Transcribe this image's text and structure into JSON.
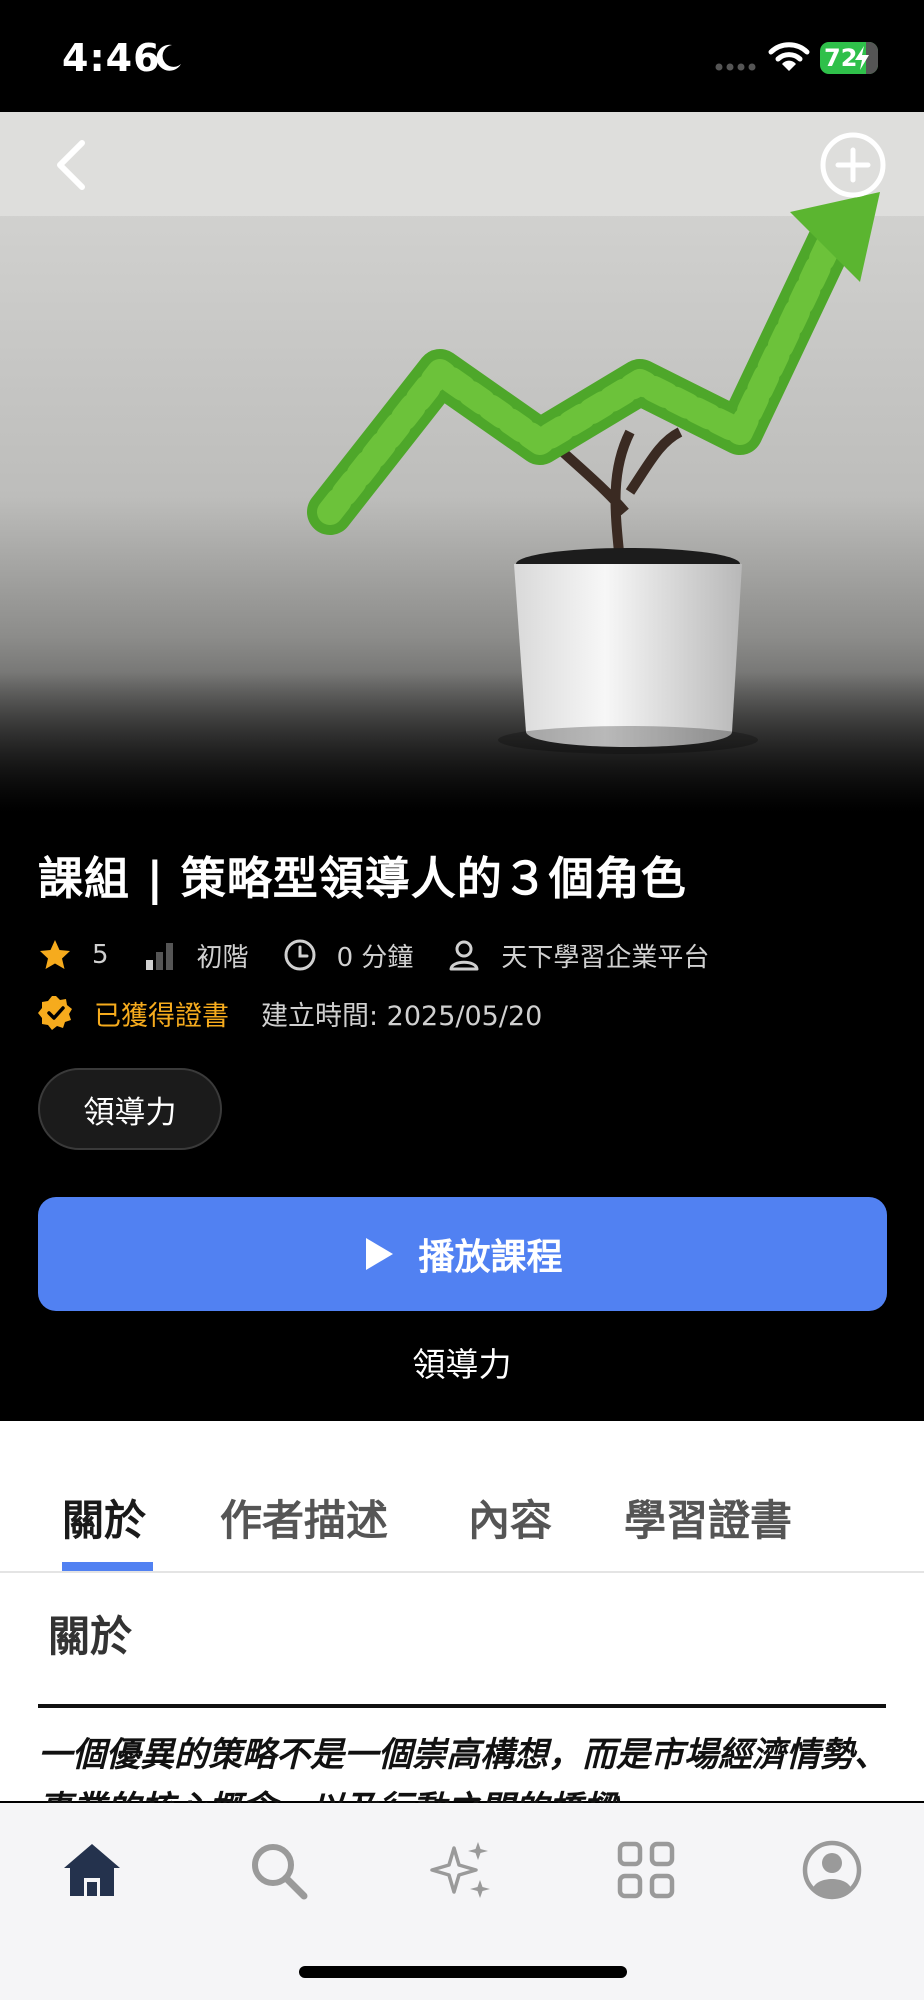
{
  "status_bar": {
    "time": "4:46",
    "battery": "72"
  },
  "hero": {
    "image_description_icon": "plant-growth-arrow-image"
  },
  "course": {
    "title": "課組 | 策略型領導人的３個角色",
    "rating": "5",
    "level": "初階",
    "duration": "0 分鐘",
    "provider": "天下學習企業平台",
    "certificate_status": "已獲得證書",
    "created_label": "建立時間: 2025/05/20",
    "tag": "領導力",
    "play_label": "播放課程",
    "category": "領導力"
  },
  "tabs": [
    {
      "label": "關於",
      "active": true
    },
    {
      "label": "作者描述",
      "active": false
    },
    {
      "label": "內容",
      "active": false
    },
    {
      "label": "學習證書",
      "active": false
    }
  ],
  "about": {
    "heading": "關於",
    "text": "一個優異的策略不是一個崇高構想，而是市場經濟情勢、事業的核心概念，以及行動之間的橋樑。"
  },
  "colors": {
    "accent": "#5181f2",
    "certificate": "#f6ab1d",
    "star": "#f6ab1d"
  },
  "bottom_nav": [
    {
      "icon": "home-icon"
    },
    {
      "icon": "search-icon"
    },
    {
      "icon": "sparkles-icon"
    },
    {
      "icon": "grid-icon"
    },
    {
      "icon": "profile-icon"
    }
  ]
}
